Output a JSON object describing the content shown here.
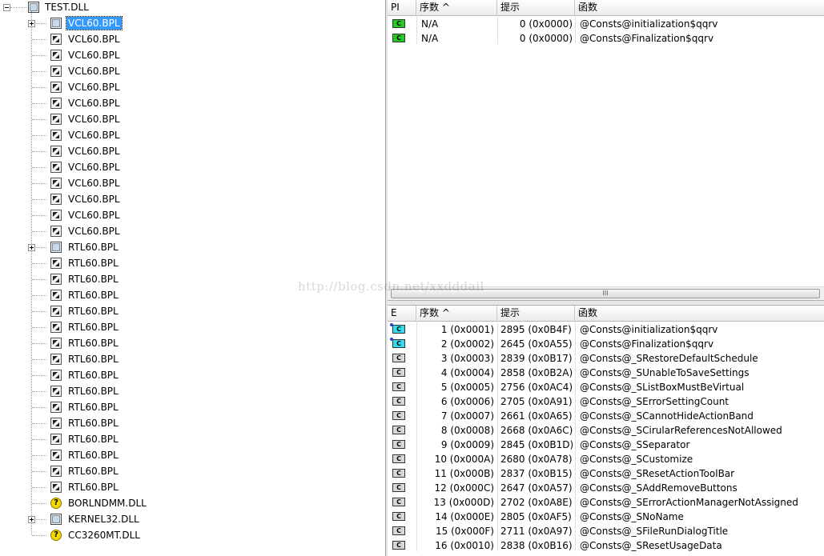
{
  "tree": {
    "root": {
      "label": "TEST.DLL",
      "expander": "minus"
    },
    "children": [
      {
        "label": "VCL60.BPL",
        "icon": "module-icon",
        "expander": "plus",
        "selected": true
      },
      {
        "label": "VCL60.BPL",
        "icon": "forward-icon"
      },
      {
        "label": "VCL60.BPL",
        "icon": "forward-icon"
      },
      {
        "label": "VCL60.BPL",
        "icon": "forward-icon"
      },
      {
        "label": "VCL60.BPL",
        "icon": "forward-icon"
      },
      {
        "label": "VCL60.BPL",
        "icon": "forward-icon"
      },
      {
        "label": "VCL60.BPL",
        "icon": "forward-icon"
      },
      {
        "label": "VCL60.BPL",
        "icon": "forward-icon"
      },
      {
        "label": "VCL60.BPL",
        "icon": "forward-icon"
      },
      {
        "label": "VCL60.BPL",
        "icon": "forward-icon"
      },
      {
        "label": "VCL60.BPL",
        "icon": "forward-icon"
      },
      {
        "label": "VCL60.BPL",
        "icon": "forward-icon"
      },
      {
        "label": "VCL60.BPL",
        "icon": "forward-icon"
      },
      {
        "label": "VCL60.BPL",
        "icon": "forward-icon"
      },
      {
        "label": "RTL60.BPL",
        "icon": "module-icon",
        "expander": "plus"
      },
      {
        "label": "RTL60.BPL",
        "icon": "forward-icon"
      },
      {
        "label": "RTL60.BPL",
        "icon": "forward-icon"
      },
      {
        "label": "RTL60.BPL",
        "icon": "forward-icon"
      },
      {
        "label": "RTL60.BPL",
        "icon": "forward-icon"
      },
      {
        "label": "RTL60.BPL",
        "icon": "forward-icon"
      },
      {
        "label": "RTL60.BPL",
        "icon": "forward-icon"
      },
      {
        "label": "RTL60.BPL",
        "icon": "forward-icon"
      },
      {
        "label": "RTL60.BPL",
        "icon": "forward-icon"
      },
      {
        "label": "RTL60.BPL",
        "icon": "forward-icon"
      },
      {
        "label": "RTL60.BPL",
        "icon": "forward-icon"
      },
      {
        "label": "RTL60.BPL",
        "icon": "forward-icon"
      },
      {
        "label": "RTL60.BPL",
        "icon": "forward-icon"
      },
      {
        "label": "RTL60.BPL",
        "icon": "forward-icon"
      },
      {
        "label": "RTL60.BPL",
        "icon": "forward-icon"
      },
      {
        "label": "RTL60.BPL",
        "icon": "forward-icon"
      },
      {
        "label": "BORLNDMM.DLL",
        "icon": "missing-module-icon"
      },
      {
        "label": "KERNEL32.DLL",
        "icon": "module-icon",
        "expander": "plus"
      },
      {
        "label": "CC3260MT.DLL",
        "icon": "missing-module-icon"
      }
    ]
  },
  "imports": {
    "headers": {
      "pi": "PI",
      "ordinal": "序数 ^",
      "hint": "提示",
      "function": "函数"
    },
    "rows": [
      {
        "icon": "green",
        "ordinal": "N/A",
        "hint": "0 (0x0000)",
        "function": "@Consts@initialization$qqrv"
      },
      {
        "icon": "green",
        "ordinal": "N/A",
        "hint": "0 (0x0000)",
        "function": "@Consts@Finalization$qqrv"
      }
    ]
  },
  "exports": {
    "headers": {
      "e": "E",
      "ordinal": "序数 ^",
      "hint": "提示",
      "function": "函数"
    },
    "rows": [
      {
        "icon": "cyan",
        "ordinal": "1 (0x0001)",
        "hint": "2895 (0x0B4F)",
        "function": "@Consts@initialization$qqrv"
      },
      {
        "icon": "cyan",
        "ordinal": "2 (0x0002)",
        "hint": "2645 (0x0A55)",
        "function": "@Consts@Finalization$qqrv"
      },
      {
        "icon": "gray",
        "ordinal": "3 (0x0003)",
        "hint": "2839 (0x0B17)",
        "function": "@Consts@_SRestoreDefaultSchedule"
      },
      {
        "icon": "gray",
        "ordinal": "4 (0x0004)",
        "hint": "2858 (0x0B2A)",
        "function": "@Consts@_SUnableToSaveSettings"
      },
      {
        "icon": "gray",
        "ordinal": "5 (0x0005)",
        "hint": "2756 (0x0AC4)",
        "function": "@Consts@_SListBoxMustBeVirtual"
      },
      {
        "icon": "gray",
        "ordinal": "6 (0x0006)",
        "hint": "2705 (0x0A91)",
        "function": "@Consts@_SErrorSettingCount"
      },
      {
        "icon": "gray",
        "ordinal": "7 (0x0007)",
        "hint": "2661 (0x0A65)",
        "function": "@Consts@_SCannotHideActionBand"
      },
      {
        "icon": "gray",
        "ordinal": "8 (0x0008)",
        "hint": "2668 (0x0A6C)",
        "function": "@Consts@_SCirularReferencesNotAllowed"
      },
      {
        "icon": "gray",
        "ordinal": "9 (0x0009)",
        "hint": "2845 (0x0B1D)",
        "function": "@Consts@_SSeparator"
      },
      {
        "icon": "gray",
        "ordinal": "10 (0x000A)",
        "hint": "2680 (0x0A78)",
        "function": "@Consts@_SCustomize"
      },
      {
        "icon": "gray",
        "ordinal": "11 (0x000B)",
        "hint": "2837 (0x0B15)",
        "function": "@Consts@_SResetActionToolBar"
      },
      {
        "icon": "gray",
        "ordinal": "12 (0x000C)",
        "hint": "2647 (0x0A57)",
        "function": "@Consts@_SAddRemoveButtons"
      },
      {
        "icon": "gray",
        "ordinal": "13 (0x000D)",
        "hint": "2702 (0x0A8E)",
        "function": "@Consts@_SErrorActionManagerNotAssigned"
      },
      {
        "icon": "gray",
        "ordinal": "14 (0x000E)",
        "hint": "2805 (0x0AF5)",
        "function": "@Consts@_SNoName"
      },
      {
        "icon": "gray",
        "ordinal": "15 (0x000F)",
        "hint": "2711 (0x0A97)",
        "function": "@Consts@_SFileRunDialogTitle"
      },
      {
        "icon": "gray",
        "ordinal": "16 (0x0010)",
        "hint": "2838 (0x0B16)",
        "function": "@Consts@_SResetUsageData"
      }
    ]
  },
  "icon_label": "C",
  "missing_icon_label": "?",
  "scroll_grip": "III",
  "watermark": "http://blog.csdn.net/xxdddail",
  "colors": {
    "selection": "#3399ff",
    "import_icon": "#22cc22",
    "export_icon": "#33ddee"
  }
}
